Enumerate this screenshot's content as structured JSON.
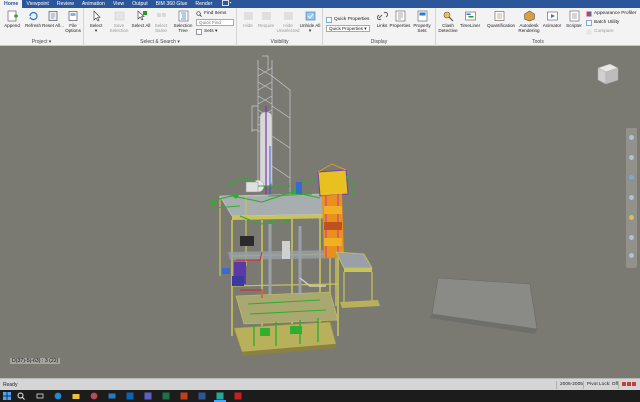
{
  "tabs": [
    "Home",
    "Viewpoint",
    "Review",
    "Animation",
    "View",
    "Output",
    "BIM 360 Glue",
    "Render"
  ],
  "ribbon": {
    "project": {
      "label": "Project",
      "append": "Append",
      "refresh": "Refresh",
      "reset_all": "Reset All...",
      "file_options": "File Options"
    },
    "select_search": {
      "label": "Select & Search",
      "select": "Select",
      "save_selection": "Save Selection",
      "select_all": "Select All",
      "select_same": "Select Same",
      "selection_tree": "Selection Tree",
      "find_items": "Find Items",
      "quick_find": "Quick Find",
      "sets": "Sets"
    },
    "visibility": {
      "label": "Visibility",
      "hide": "Hide",
      "require": "Require",
      "hide_unselected": "Hide Unselected",
      "unhide_all": "Unhide All"
    },
    "display": {
      "label": "Display",
      "quick_properties": "Quick Properties",
      "quick_properties_combo": "Quick Properties",
      "links": "Links",
      "properties": "Properties",
      "property_sets": "Property Sets"
    },
    "tools": {
      "label": "Tools",
      "clash_detective": "Clash Detective",
      "timeliner": "TimeLiner",
      "quantification": "Quantification",
      "autodesk_rendering": "Autodesk Rendering",
      "animator": "Animator",
      "scripter": "Scripter",
      "appearance_profiler": "Appearance Profiler",
      "batch_utility": "Batch Utility",
      "compare": "Compare"
    }
  },
  "viewport": {
    "coords": "D(37)-5(-63) : 3 (22)"
  },
  "status": {
    "ready": "Ready",
    "sheet": "2006-2005",
    "pivot": "Pivot Lock: Off"
  },
  "colors": {
    "ribbon_blue": "#2b579a",
    "viewport_bg": "#7a7a72",
    "structure_yellow": "#c9c45a",
    "steel_gray": "#9aa0a8",
    "equipment_green": "#2fae2f",
    "equipment_orange": "#e8901a",
    "vessel_purple": "#5a3aa8"
  }
}
